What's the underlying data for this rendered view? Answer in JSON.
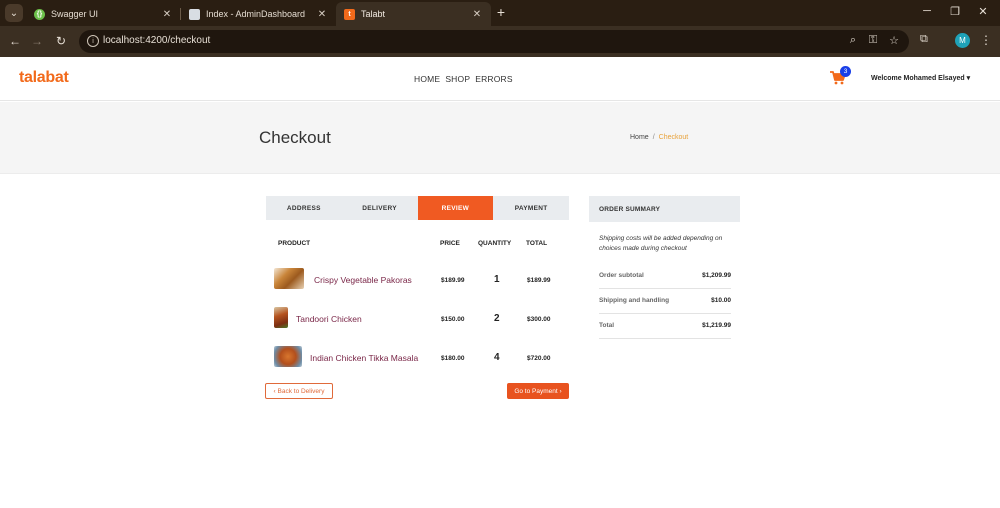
{
  "browser": {
    "tabs": [
      {
        "label": "Swagger UI",
        "fav_color": "#6cc04a",
        "fav_glyph": "{}"
      },
      {
        "label": "Index - AdminDashboard",
        "fav_color": "#d8dde3",
        "fav_glyph": ""
      },
      {
        "label": "Talabt",
        "fav_color": "#f26a1b",
        "fav_glyph": "t"
      }
    ],
    "url": "localhost:4200/checkout"
  },
  "site": {
    "logo": "talabat",
    "nav": [
      "HOME",
      "SHOP",
      "ERRORS"
    ],
    "cart_count": "3",
    "welcome": "Welcome Mohamed Elsayed ▾"
  },
  "banner": {
    "title": "Checkout",
    "breadcrumb_home": "Home",
    "breadcrumb_sep": "/",
    "breadcrumb_current": "Checkout"
  },
  "steps": [
    "ADDRESS",
    "DELIVERY",
    "REVIEW",
    "PAYMENT"
  ],
  "table": {
    "headers": {
      "product": "PRODUCT",
      "price": "PRICE",
      "quantity": "QUANTITY",
      "total": "TOTAL"
    },
    "rows": [
      {
        "name": "Crispy Vegetable Pakoras",
        "price": "$189.99",
        "qty": "1",
        "total": "$189.99"
      },
      {
        "name": "Tandoori Chicken",
        "price": "$150.00",
        "qty": "2",
        "total": "$300.00"
      },
      {
        "name": "Indian Chicken Tikka Masala",
        "price": "$180.00",
        "qty": "4",
        "total": "$720.00"
      }
    ]
  },
  "buttons": {
    "back": "‹ Back to Delivery",
    "next": "Go to Payment ›"
  },
  "summary": {
    "title": "ORDER SUMMARY",
    "note": "Shipping costs will be added depending on choices made during checkout",
    "rows": [
      {
        "label": "Order subtotal",
        "value": "$1,209.99"
      },
      {
        "label": "Shipping and handling",
        "value": "$10.00"
      },
      {
        "label": "Total",
        "value": "$1,219.99"
      }
    ]
  },
  "colors": {
    "brand": "#f26a1b",
    "active_step": "#f05a22",
    "product_link": "#7a2748",
    "badge": "#1a3fe8"
  }
}
